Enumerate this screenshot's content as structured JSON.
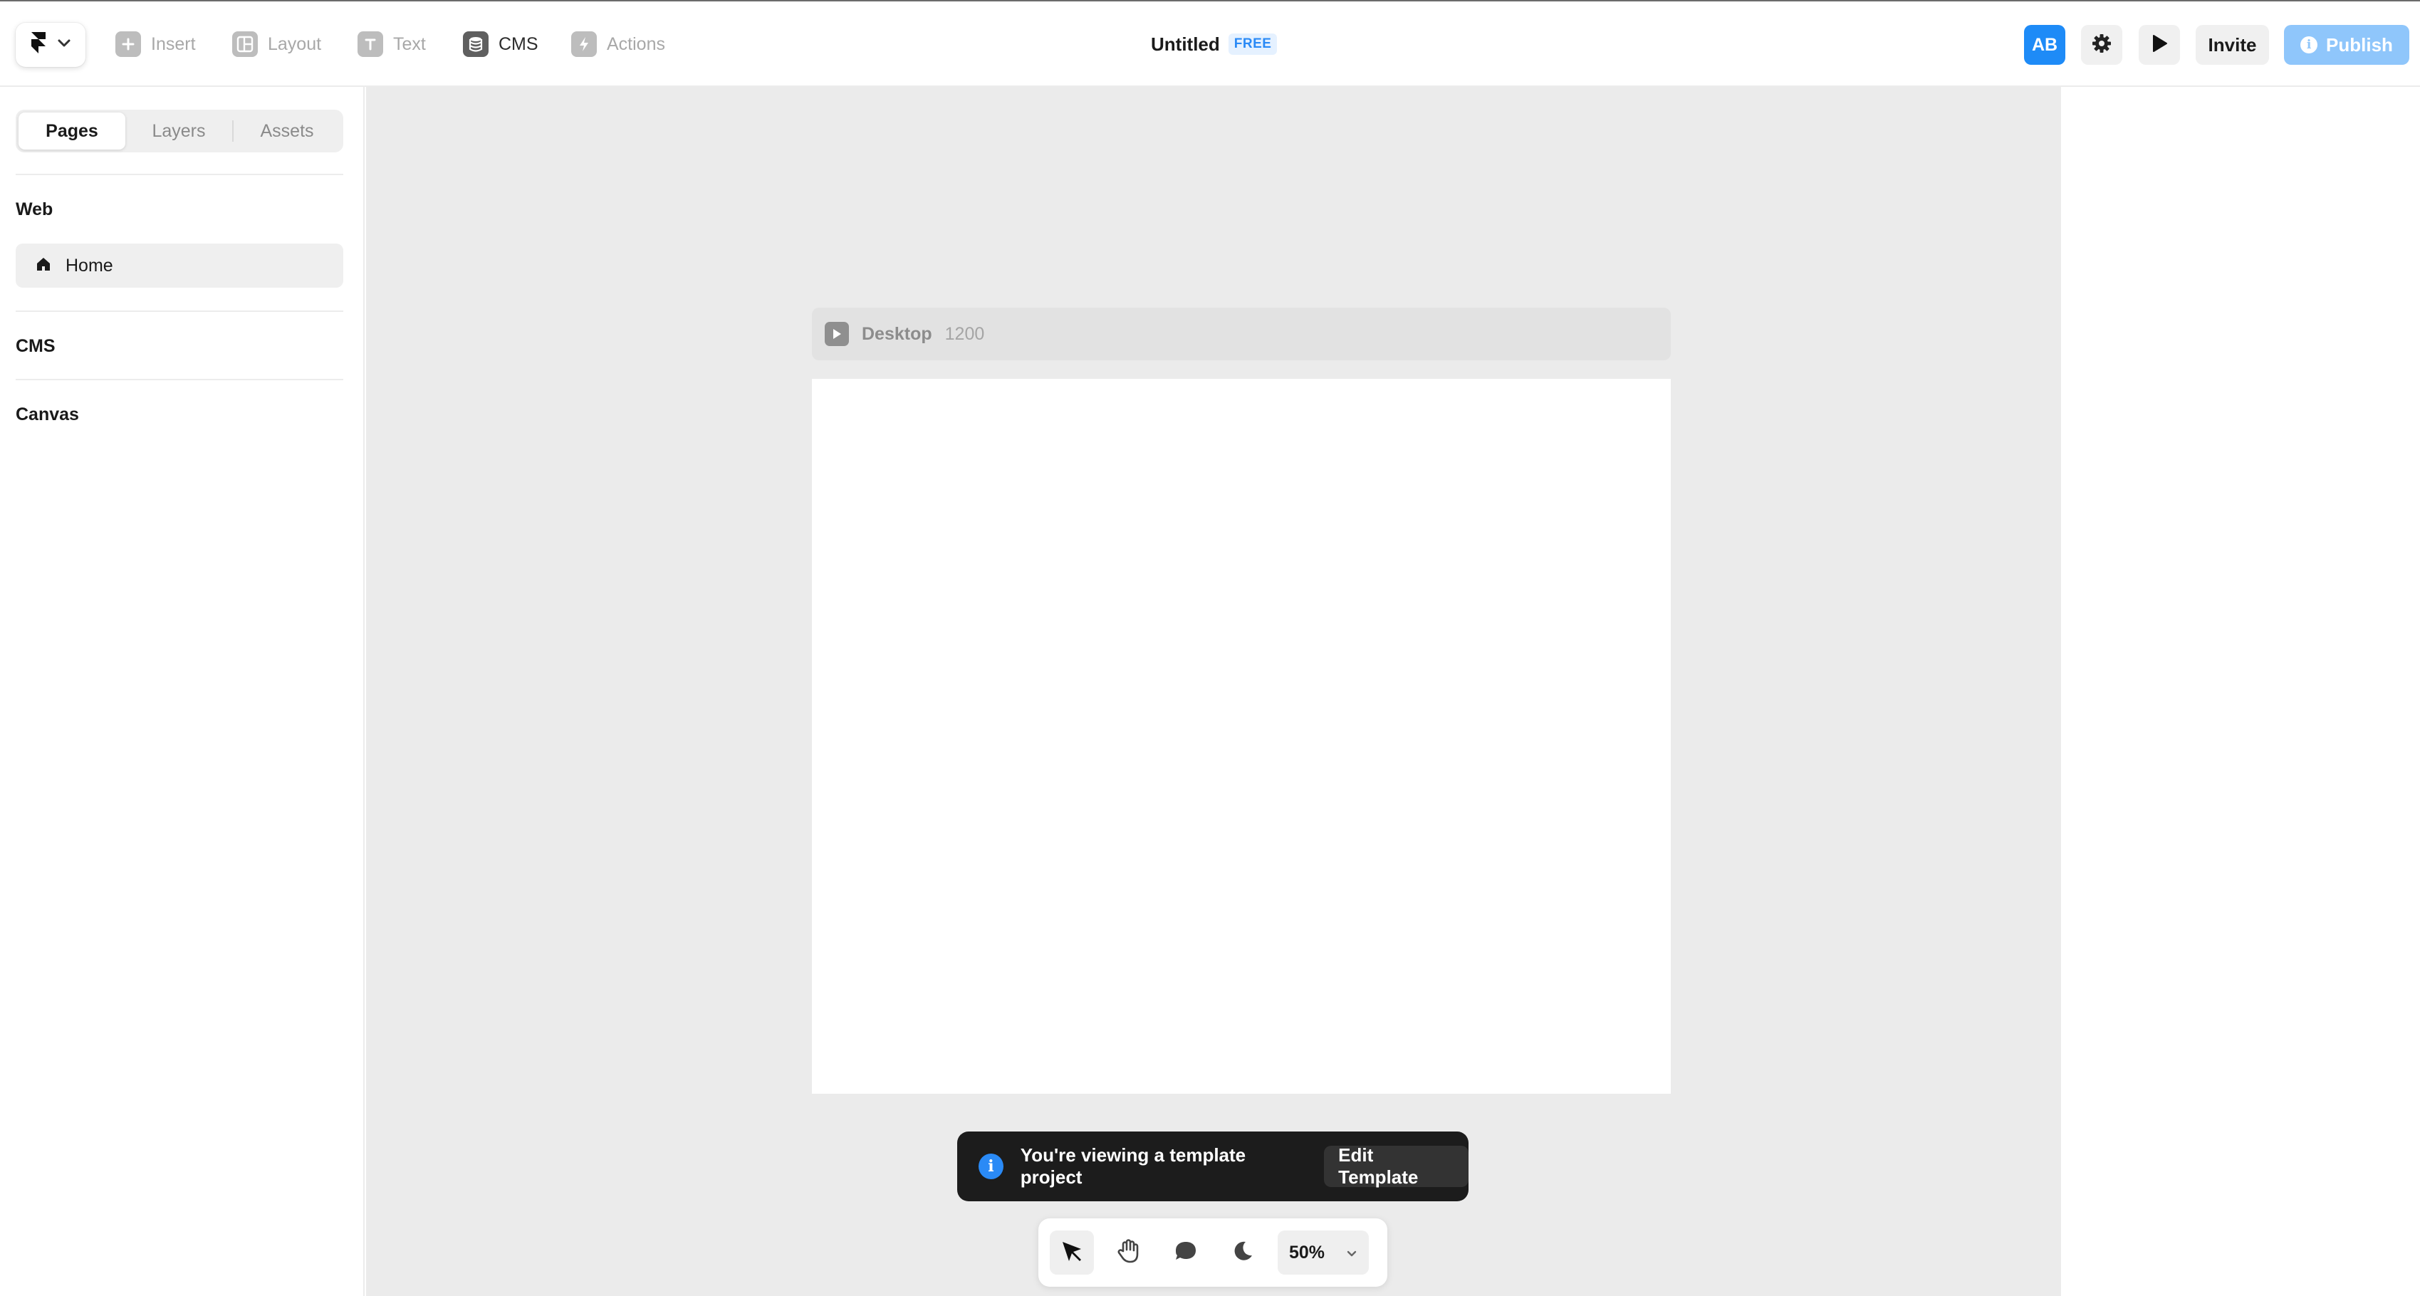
{
  "toolbar": {
    "logo_icon": "framer-logo-icon",
    "items": [
      {
        "label": "Insert",
        "icon": "plus-icon"
      },
      {
        "label": "Layout",
        "icon": "layout-icon"
      },
      {
        "label": "Text",
        "icon": "text-icon"
      },
      {
        "label": "CMS",
        "icon": "database-icon"
      },
      {
        "label": "Actions",
        "icon": "lightning-icon"
      }
    ],
    "title": "Untitled",
    "plan_badge": "FREE",
    "avatar_initials": "AB",
    "invite_label": "Invite",
    "publish_label": "Publish",
    "accent_color": "#1e8bf7"
  },
  "sidebar": {
    "tabs": [
      "Pages",
      "Layers",
      "Assets"
    ],
    "active_tab": "Pages",
    "sections": {
      "web": "Web",
      "cms": "CMS",
      "canvas": "Canvas"
    },
    "pages": [
      {
        "label": "Home",
        "icon": "home-icon"
      }
    ]
  },
  "canvas": {
    "frame_name": "Desktop",
    "frame_width": "1200",
    "background": "#ebebeb"
  },
  "toast": {
    "message": "You're viewing a template project",
    "action_label": "Edit Template"
  },
  "dock": {
    "tools": [
      "pointer-icon",
      "hand-icon",
      "comment-icon",
      "moon-icon"
    ],
    "zoom": "50%"
  }
}
